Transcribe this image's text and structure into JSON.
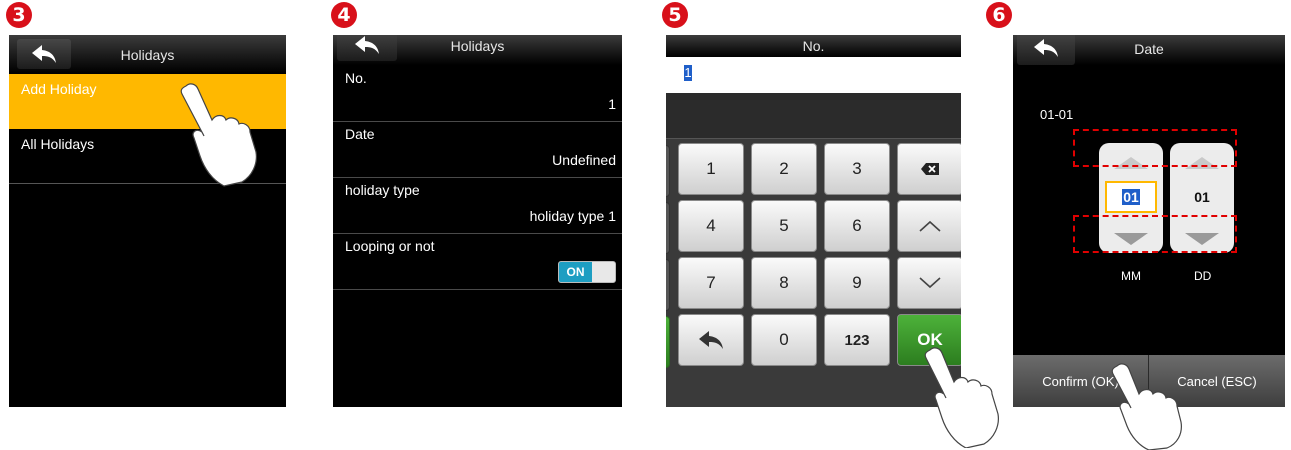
{
  "steps": [
    {
      "number": "3"
    },
    {
      "number": "4"
    },
    {
      "number": "5"
    },
    {
      "number": "6"
    }
  ],
  "screen3": {
    "title": "Holidays",
    "items": [
      {
        "label": "Add Holiday",
        "selected": true
      },
      {
        "label": "All Holidays",
        "selected": false
      }
    ]
  },
  "screen4": {
    "title": "Holidays",
    "rows": [
      {
        "label": "No.",
        "value": "1"
      },
      {
        "label": "Date",
        "value": "Undefined"
      },
      {
        "label": "holiday type",
        "value": "holiday type 1"
      },
      {
        "label": "Looping or not",
        "toggle": "ON"
      }
    ]
  },
  "screen5": {
    "title": "No.",
    "input_value": "1",
    "keys": [
      "1",
      "2",
      "3",
      "backspace-icon",
      "4",
      "5",
      "6",
      "up-icon",
      "7",
      "8",
      "9",
      "down-icon",
      "back-icon",
      "0",
      "123",
      "OK"
    ],
    "ok_label": "OK",
    "mode_label": "123"
  },
  "screen6": {
    "title": "Date",
    "date_value": "01-01",
    "month": {
      "value": "01",
      "label": "MM"
    },
    "day": {
      "value": "01",
      "label": "DD"
    },
    "confirm_label": "Confirm (OK)",
    "cancel_label": "Cancel (ESC)"
  },
  "colors": {
    "highlight": "#ffb800",
    "badge": "#d8101a",
    "toggle_on": "#1e9ec2",
    "ok_key": "#3f9b2e",
    "dashed_marker": "#e00000"
  }
}
